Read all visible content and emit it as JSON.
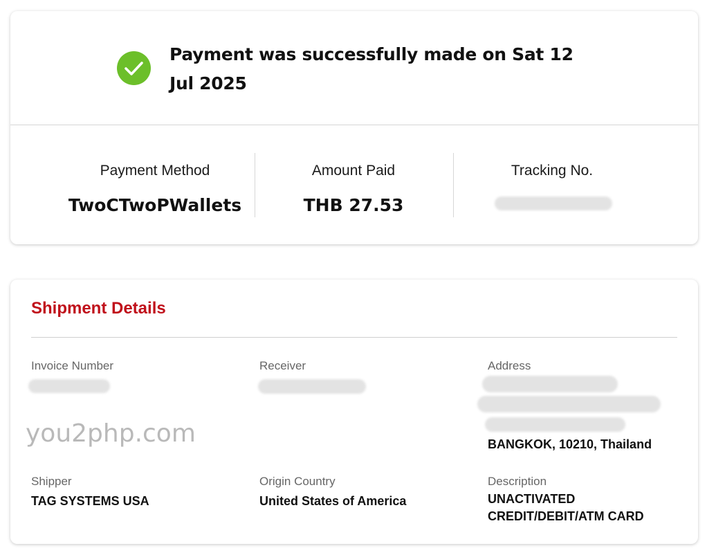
{
  "header": {
    "success_icon": "checkmark-circle-icon",
    "success_color": "#6cbf2a",
    "success_message": "Payment was successfully made on Sat 12 Jul 2025"
  },
  "summary": {
    "payment_method_label": "Payment Method",
    "payment_method_value": "TwoCTwoPWallets",
    "amount_label": "Amount Paid",
    "amount_value": "THB 27.53",
    "tracking_label": "Tracking No."
  },
  "shipment": {
    "title": "Shipment Details",
    "title_color": "#c0111b",
    "invoice_label": "Invoice Number",
    "receiver_label": "Receiver",
    "address_label": "Address",
    "address_visible_line": "BANGKOK, 10210, Thailand",
    "shipper_label": "Shipper",
    "shipper_value": "TAG SYSTEMS USA",
    "origin_label": "Origin Country",
    "origin_value": "United States of America",
    "description_label": "Description",
    "description_line1": "UNACTIVATED",
    "description_line2": "CREDIT/DEBIT/ATM CARD"
  },
  "watermark": "you2php.com"
}
